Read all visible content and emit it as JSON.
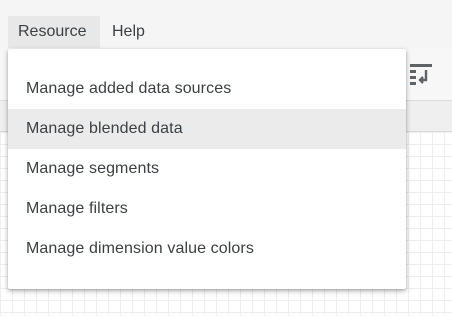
{
  "menubar": {
    "items": [
      {
        "label": "Resource"
      },
      {
        "label": "Help"
      }
    ]
  },
  "dropdown": {
    "items": [
      {
        "label": "Manage added data sources"
      },
      {
        "label": "Manage blended data"
      },
      {
        "label": "Manage segments"
      },
      {
        "label": "Manage filters"
      },
      {
        "label": "Manage dimension value colors"
      }
    ],
    "highlighted_index": 1
  },
  "toolbar": {
    "icons": [
      "report-layout-icon"
    ]
  },
  "colors": {
    "menubar_bg": "#f5f5f5",
    "active_menu_bg": "#e8e8e8",
    "dropdown_hover_bg": "#ebebeb",
    "text": "#3c4043",
    "icon": "#5f6368"
  }
}
